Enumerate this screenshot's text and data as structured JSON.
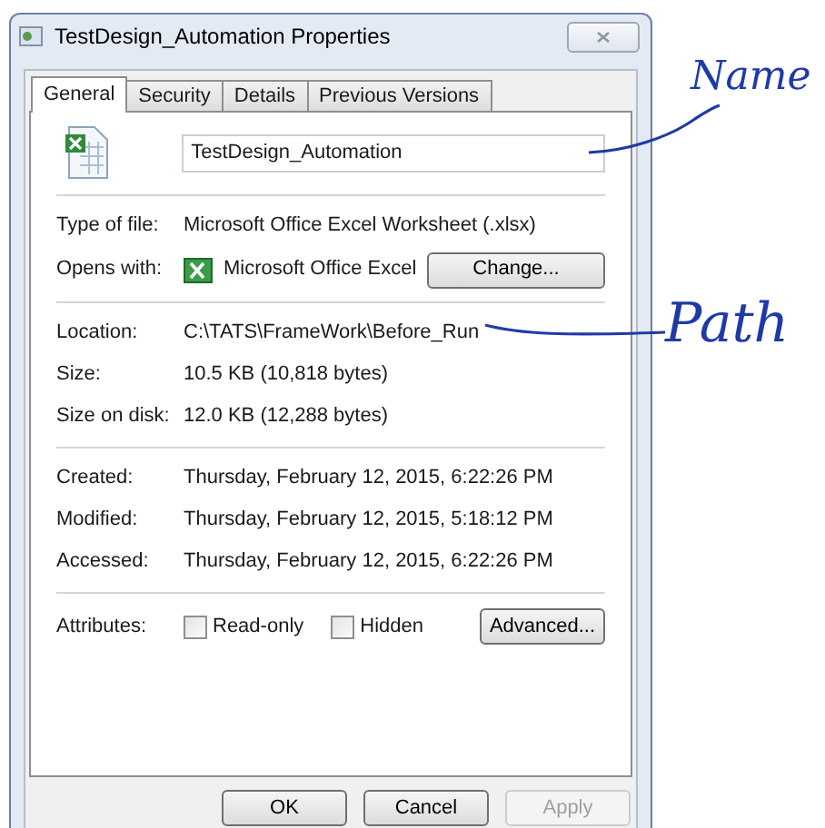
{
  "window": {
    "title": "TestDesign_Automation Properties"
  },
  "tabs": [
    {
      "label": "General",
      "selected": true
    },
    {
      "label": "Security",
      "selected": false
    },
    {
      "label": "Details",
      "selected": false
    },
    {
      "label": "Previous Versions",
      "selected": false
    }
  ],
  "file_name": {
    "value": "TestDesign_Automation"
  },
  "groups": [
    [
      {
        "kind": "text",
        "label": "Type of file:",
        "value": "Microsoft Office Excel Worksheet (.xlsx)"
      },
      {
        "kind": "app",
        "label": "Opens with:",
        "value": "Microsoft Office Excel",
        "button": "Change..."
      }
    ],
    [
      {
        "kind": "text",
        "label": "Location:",
        "value": "C:\\TATS\\FrameWork\\Before_Run"
      },
      {
        "kind": "text",
        "label": "Size:",
        "value": "10.5 KB (10,818 bytes)"
      },
      {
        "kind": "text",
        "label": "Size on disk:",
        "value": "12.0 KB (12,288 bytes)"
      }
    ],
    [
      {
        "kind": "text",
        "label": "Created:",
        "value": "Thursday, February 12, 2015, 6:22:26 PM"
      },
      {
        "kind": "text",
        "label": "Modified:",
        "value": "Thursday, February 12, 2015, 5:18:12 PM"
      },
      {
        "kind": "text",
        "label": "Accessed:",
        "value": "Thursday, February 12, 2015, 6:22:26 PM"
      }
    ],
    [
      {
        "kind": "attributes",
        "label": "Attributes:",
        "checkboxes": [
          {
            "label": "Read-only",
            "checked": false
          },
          {
            "label": "Hidden",
            "checked": false
          }
        ],
        "button": "Advanced..."
      }
    ]
  ],
  "buttons": [
    {
      "label": "OK",
      "disabled": false
    },
    {
      "label": "Cancel",
      "disabled": false
    },
    {
      "label": "Apply",
      "disabled": true
    }
  ],
  "annotations": [
    {
      "text": "Name"
    },
    {
      "text": "Path"
    }
  ]
}
